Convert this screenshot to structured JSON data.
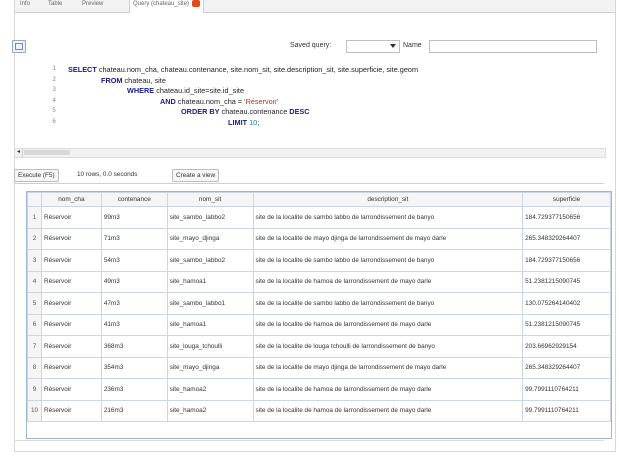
{
  "tabs": [
    "Info",
    "Table",
    "Preview",
    "Query (chateau_site)"
  ],
  "toolbar": {
    "saved_query_label": "Saved query:",
    "name_label": "Name"
  },
  "editor": {
    "lines": [
      {
        "n": "1",
        "parts": [
          {
            "t": "SELECT",
            "k": "kw"
          },
          {
            "t": " chateau.nom_cha, chateau.contenance, site.nom_sit, site.description_sit, site.superficie, site.geom",
            "k": ""
          }
        ]
      },
      {
        "n": "2",
        "parts": [
          {
            "t": "FROM",
            "k": "kw"
          },
          {
            "t": " chateau, site",
            "k": ""
          }
        ]
      },
      {
        "n": "3",
        "parts": [
          {
            "t": "WHERE",
            "k": "kw"
          },
          {
            "t": " chateau.id_site=site.id_site",
            "k": ""
          }
        ]
      },
      {
        "n": "4",
        "parts": [
          {
            "t": "AND",
            "k": "kw"
          },
          {
            "t": " chateau.nom_cha = ",
            "k": ""
          },
          {
            "t": "'Réservoir'",
            "k": "str"
          }
        ]
      },
      {
        "n": "5",
        "parts": [
          {
            "t": "ORDER BY",
            "k": "kw"
          },
          {
            "t": " chateau.contenance ",
            "k": ""
          },
          {
            "t": "DESC",
            "k": "kw"
          }
        ]
      },
      {
        "n": "6",
        "parts": [
          {
            "t": "LIMIT",
            "k": "kw"
          },
          {
            "t": " ",
            "k": ""
          },
          {
            "t": "10",
            "k": "num"
          },
          {
            "t": ";",
            "k": ""
          }
        ]
      }
    ]
  },
  "exec": {
    "execute_label": "Execute (F5)",
    "rows_info": "10 rows, 0.0 seconds",
    "create_view_label": "Create a view"
  },
  "grid": {
    "columns": [
      "nom_cha",
      "contenance",
      "nom_sit",
      "description_sit",
      "superficie"
    ],
    "rows": [
      [
        "1",
        "Réservoir",
        "99m3",
        "site_sambo_labbo2",
        "site de la localite de sambo labbo de larrondissement de banyo",
        "184.729377150656"
      ],
      [
        "2",
        "Réservoir",
        "71m3",
        "site_mayo_djinga",
        "site de la localite de mayo djinga de larrondissement de mayo darle",
        "265.348329264407"
      ],
      [
        "3",
        "Réservoir",
        "54m3",
        "site_sambo_labbo2",
        "site de la localite de sambo labbo de larrondissement de banyo",
        "184.729377150656"
      ],
      [
        "4",
        "Réservoir",
        "49m3",
        "site_hamoa1",
        "site de la localite de hamoa de larrondissement de mayo darle",
        "51.2381215090745"
      ],
      [
        "5",
        "Réservoir",
        "47m3",
        "site_sambo_labbo1",
        "site de la localite de sambo labbo de larrondissement de banyo",
        "130.075264140402"
      ],
      [
        "6",
        "Réservoir",
        "41m3",
        "site_hamoa1",
        "site de la localite de hamoa de larrondissement de mayo darle",
        "51.2381215090745"
      ],
      [
        "7",
        "Réservoir",
        "368m3",
        "site_louga_tchoulli",
        "site de la localite de louga tchoulli de larrondissement de banyo",
        "203.66962929154"
      ],
      [
        "8",
        "Réservoir",
        "354m3",
        "site_mayo_djinga",
        "site de la localite de mayo djinga de larrondissement de mayo darle",
        "265.348329264407"
      ],
      [
        "9",
        "Réservoir",
        "236m3",
        "site_hamoa2",
        "site de la localite de hamoa de larrondissement de mayo darle",
        "99.7991110764211"
      ],
      [
        "10",
        "Réservoir",
        "216m3",
        "site_hamoa2",
        "site de la localite de hamoa de larrondissement de mayo darle",
        "99.7991110764211"
      ]
    ]
  }
}
